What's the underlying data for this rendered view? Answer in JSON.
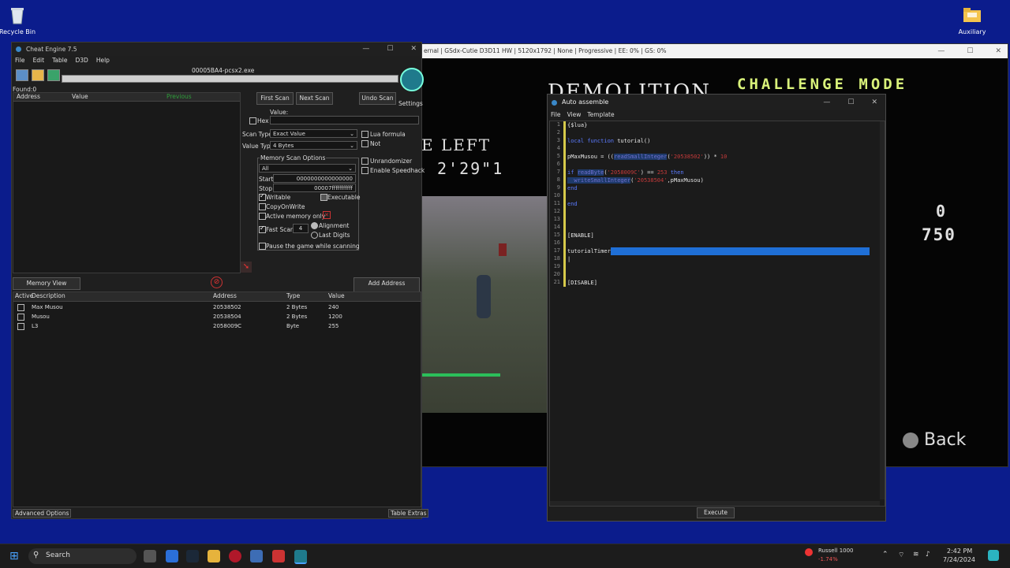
{
  "desktop": {
    "icons": [
      {
        "label": "Recycle Bin"
      },
      {
        "label": "Auxiliary"
      }
    ]
  },
  "game": {
    "title": "ernal | GSdx-Cutie D3D11 HW | 5120x1792 | None | Progressive | EE:  0% | GS:  0%",
    "demolition": "DEMOLITION",
    "challenge_mode": "CHALLENGE MODE",
    "time_left_label": "E LEFT",
    "time_value": "2'29\"1",
    "score_0": "0",
    "score_750": "750",
    "back_label": "Back"
  },
  "cheat_engine": {
    "title": "Cheat Engine 7.5",
    "menu": [
      "File",
      "Edit",
      "Table",
      "D3D",
      "Help"
    ],
    "process": "00005BA4-pcsx2.exe",
    "found": "Found:0",
    "list_headers": [
      "Address",
      "Value",
      "Previous"
    ],
    "buttons": {
      "first_scan": "First Scan",
      "next_scan": "Next Scan",
      "undo_scan": "Undo Scan",
      "settings": "Settings",
      "memory_view": "Memory View",
      "add_address": "Add Address Manually",
      "advanced_options": "Advanced Options",
      "table_extras": "Table Extras"
    },
    "value_label": "Value:",
    "hex_label": "Hex",
    "scan_type_label": "Scan Type",
    "scan_type_value": "Exact Value",
    "value_type_label": "Value Type",
    "value_type_value": "4 Bytes",
    "lua_formula": "Lua formula",
    "not_label": "Not",
    "memory_options_title": "Memory Scan Options",
    "memory_region": "All",
    "start_label": "Start",
    "start_value": "0000000000000000",
    "stop_label": "Stop",
    "stop_value": "00007fffffffffff",
    "writable": "Writable",
    "executable": "Executable",
    "copy_on_write": "CopyOnWrite",
    "active_memory_only": "Active memory only",
    "fast_scan": "Fast Scan",
    "fast_scan_value": "4",
    "alignment": "Alignment",
    "last_digits": "Last Digits",
    "pause_game": "Pause the game while scanning",
    "unrandomizer": "Unrandomizer",
    "enable_speedhack": "Enable Speedhack",
    "table_headers": [
      "Active",
      "Description",
      "Address",
      "Type",
      "Value"
    ],
    "table_rows": [
      {
        "desc": "Max Musou",
        "addr": "20538502",
        "type": "2 Bytes",
        "value": "240"
      },
      {
        "desc": "Musou",
        "addr": "20538504",
        "type": "2 Bytes",
        "value": "1200"
      },
      {
        "desc": "L3",
        "addr": "2058009C",
        "type": "Byte",
        "value": "255"
      }
    ]
  },
  "auto_assemble": {
    "title": "Auto assemble",
    "menu": [
      "File",
      "View",
      "Template"
    ],
    "execute": "Execute",
    "line_numbers": [
      "1",
      "2",
      "3",
      "4",
      "5",
      "6",
      "7",
      "8",
      "9",
      "10",
      "11",
      "12",
      "13",
      "14",
      "15",
      "16",
      "17",
      "18",
      "19",
      "20",
      "21"
    ],
    "code": {
      "l1": "{$lua}",
      "l3a": "local function ",
      "l3b": "tutorial()",
      "l5a": "pMaxMusou = ((",
      "l5b": "readSmallInteger",
      "l5c": "(",
      "l5d": "'20538502'",
      "l5e": ")) * ",
      "l5f": "10",
      "l7a": "if ",
      "l7b": "readByte",
      "l7c": "(",
      "l7d": "'2058009C'",
      "l7e": ") == ",
      "l7f": "253",
      "l7g": " then",
      "l8a": "  writeSmallInteger",
      "l8b": "(",
      "l8c": "'20538504'",
      "l8d": ",pMaxMusou)",
      "l9": "end",
      "l11": "end",
      "l15": "[ENABLE]",
      "l17a": "tutorialTimer",
      "l21": "[DISABLE]"
    }
  },
  "taskbar": {
    "search": "Search",
    "stock_name": "Russell 1000",
    "stock_change": "-1.74%",
    "time": "2:42 PM",
    "date": "7/24/2024"
  },
  "colors": {
    "desktop": "#0b1c8c",
    "selection": "#1f6fd6"
  }
}
